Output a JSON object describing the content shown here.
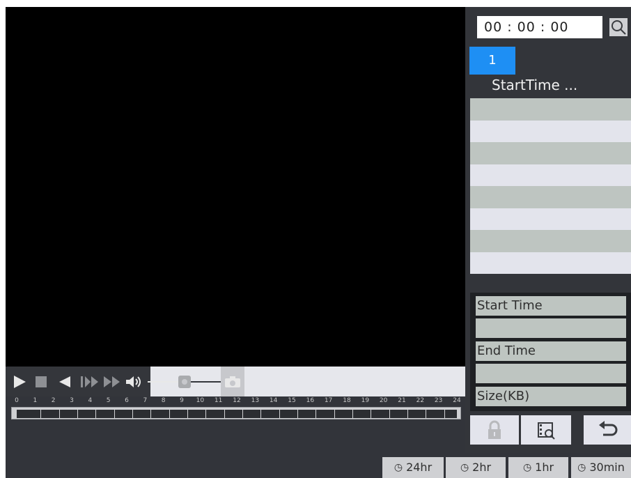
{
  "search": {
    "time_value": "00 : 00 : 00",
    "search_icon": "search-icon"
  },
  "file_list": {
    "tab_label": "1",
    "header": "StartTime ...",
    "rows": [
      "",
      "",
      "",
      "",
      "",
      "",
      "",
      ""
    ]
  },
  "info": {
    "start_time_label": "Start Time",
    "start_time_value": "",
    "end_time_label": "End Time",
    "end_time_value": "",
    "size_label": "Size(KB)"
  },
  "controls": {
    "icons": [
      "play-icon",
      "stop-icon",
      "reverse-play-icon",
      "slow-play-icon",
      "fast-forward-icon",
      "volume-icon",
      "snapshot-icon"
    ]
  },
  "timeline": {
    "hours": [
      "0",
      "1",
      "2",
      "3",
      "4",
      "5",
      "6",
      "7",
      "8",
      "9",
      "10",
      "11",
      "12",
      "13",
      "14",
      "15",
      "16",
      "17",
      "18",
      "19",
      "20",
      "21",
      "22",
      "23",
      "24"
    ]
  },
  "side_buttons": {
    "icons": [
      "lock-icon",
      "file-search-icon",
      "back-icon"
    ]
  },
  "modes": [
    {
      "label": "24hr",
      "icon": "clock-icon"
    },
    {
      "label": "2hr",
      "icon": "clock-icon"
    },
    {
      "label": "1hr",
      "icon": "clock-icon"
    },
    {
      "label": "30min",
      "icon": "clock-icon"
    }
  ],
  "colors": {
    "accent": "#1e8ff4",
    "panel": "#33353a",
    "row_alt": "#bec5c1",
    "row": "#e3e4ec"
  }
}
